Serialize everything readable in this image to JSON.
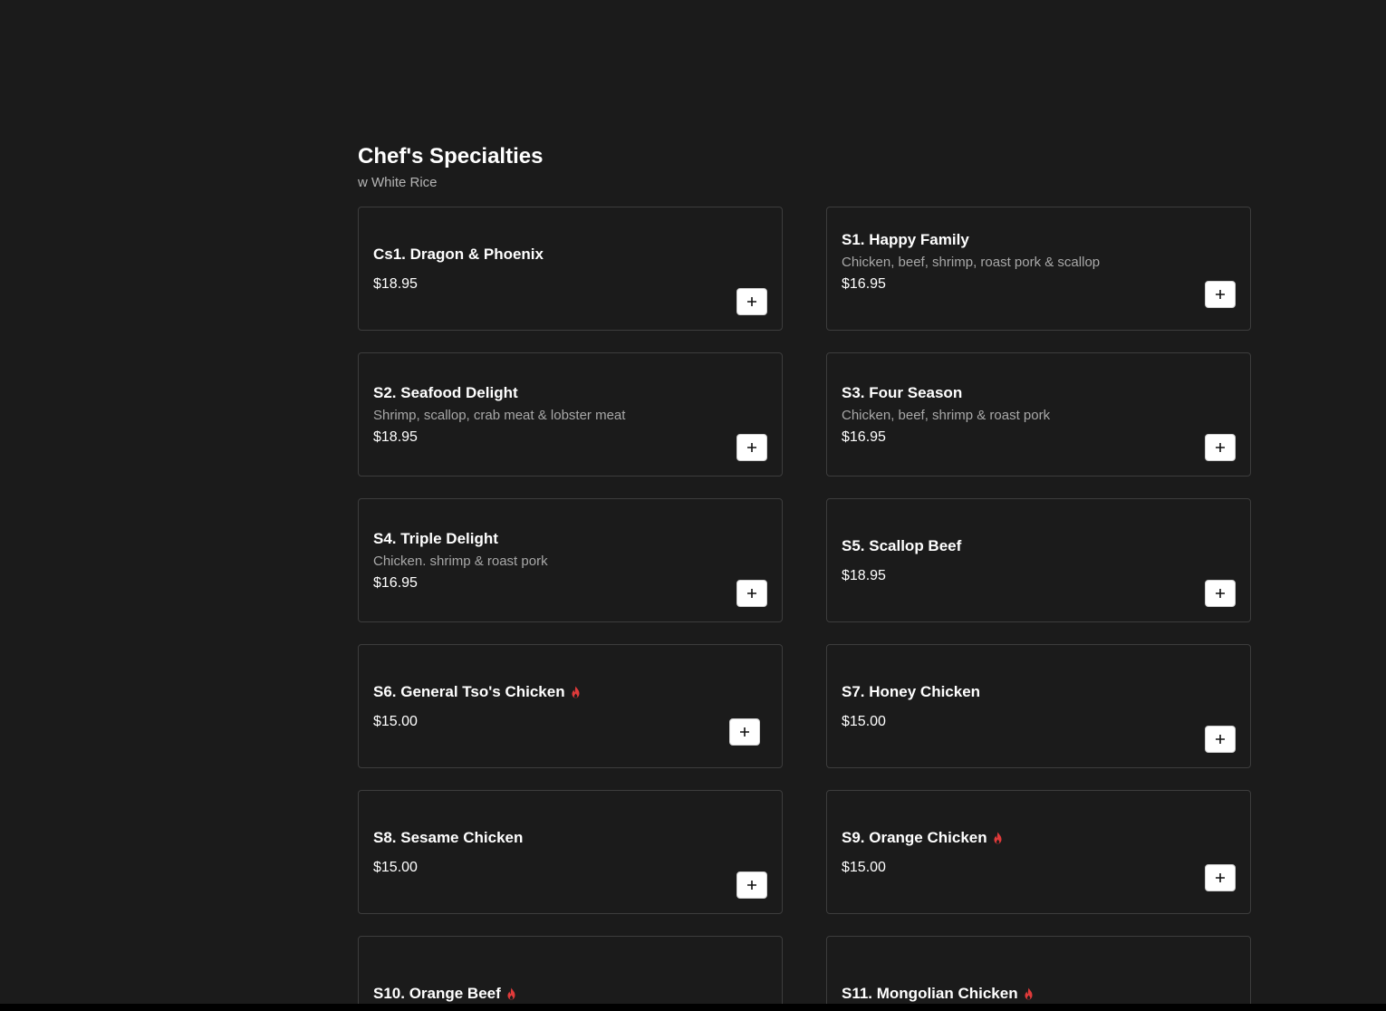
{
  "section": {
    "title": "Chef's Specialties",
    "subtitle": "w White Rice"
  },
  "items": [
    {
      "name": "Cs1. Dragon & Phoenix",
      "description": "",
      "price": "$18.95",
      "spicy": false
    },
    {
      "name": "S1. Happy Family",
      "description": "Chicken, beef, shrimp, roast pork & scallop",
      "price": "$16.95",
      "spicy": false
    },
    {
      "name": "S2. Seafood Delight",
      "description": "Shrimp, scallop, crab meat & lobster meat",
      "price": "$18.95",
      "spicy": false
    },
    {
      "name": "S3. Four Season",
      "description": "Chicken, beef, shrimp & roast pork",
      "price": "$16.95",
      "spicy": false
    },
    {
      "name": "S4. Triple Delight",
      "description": "Chicken. shrimp & roast pork",
      "price": "$16.95",
      "spicy": false
    },
    {
      "name": "S5. Scallop Beef",
      "description": "",
      "price": "$18.95",
      "spicy": false
    },
    {
      "name": "S6. General Tso's Chicken",
      "description": "",
      "price": "$15.00",
      "spicy": true
    },
    {
      "name": "S7. Honey Chicken",
      "description": "",
      "price": "$15.00",
      "spicy": false
    },
    {
      "name": "S8. Sesame Chicken",
      "description": "",
      "price": "$15.00",
      "spicy": false
    },
    {
      "name": "S9. Orange Chicken",
      "description": "",
      "price": "$15.00",
      "spicy": true
    },
    {
      "name": "S10. Orange Beef",
      "description": "",
      "price": "",
      "spicy": true
    },
    {
      "name": "S11. Mongolian Chicken",
      "description": "",
      "price": "",
      "spicy": true
    }
  ],
  "icons": {
    "add": "plus-icon",
    "spicy": "flame-icon"
  },
  "colors": {
    "background": "#1b1b1b",
    "card_border": "#3d3d3d",
    "spicy": "#e03a3a",
    "add_button_bg": "#ffffff"
  }
}
